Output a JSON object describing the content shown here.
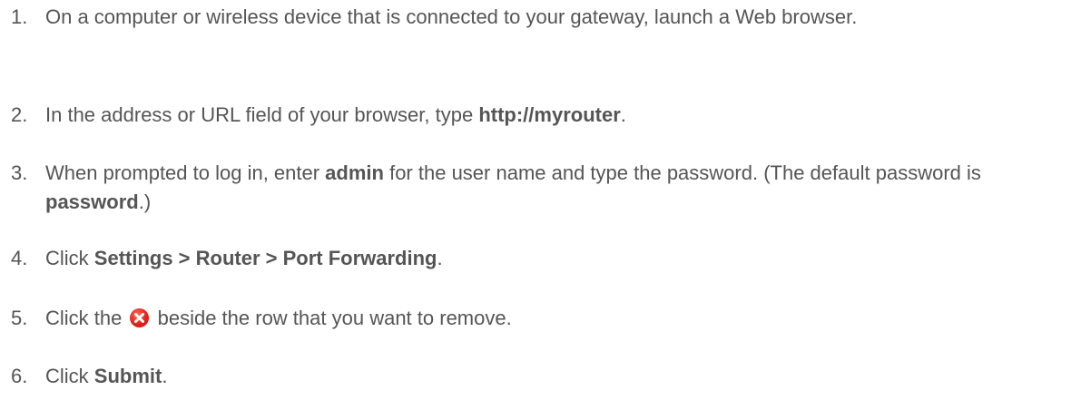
{
  "steps": [
    {
      "number": "1.",
      "text": "On a computer or wireless device that is connected to your gateway, launch a Web browser."
    },
    {
      "number": "2.",
      "pre": "In the address or URL field of your browser, type ",
      "bold": "http://myrouter",
      "post": "."
    },
    {
      "number": "3.",
      "pre": "When prompted to log in, enter ",
      "bold1": "admin",
      "mid": " for the user name and type the password. (The default password is ",
      "bold2": "password",
      "post": ".)"
    },
    {
      "number": "4.",
      "pre": "Click ",
      "bold": "Settings > Router > Port Forwarding",
      "post": "."
    },
    {
      "number": "5.",
      "pre": "Click the",
      "icon": "delete-x-icon",
      "post": "beside the row that you want to remove."
    },
    {
      "number": "6.",
      "pre": "Click ",
      "bold": "Submit",
      "post": "."
    }
  ]
}
